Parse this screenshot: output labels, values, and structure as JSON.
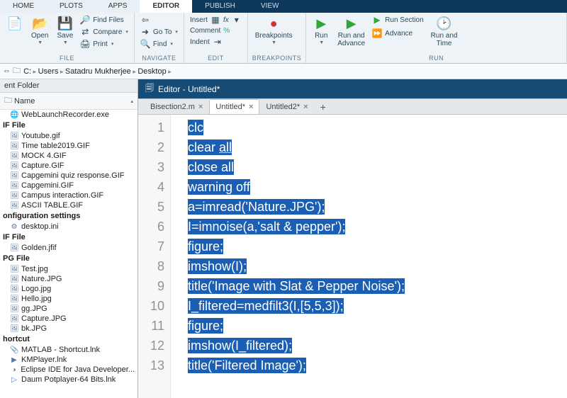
{
  "menutabs": [
    "HOME",
    "PLOTS",
    "APPS",
    "EDITOR",
    "PUBLISH",
    "VIEW"
  ],
  "active_menutab": 3,
  "ribbon": {
    "file": {
      "label": "FILE",
      "open": "Open",
      "save": "Save",
      "find_files": "Find Files",
      "compare": "Compare",
      "print": "Print"
    },
    "navigate": {
      "label": "NAVIGATE",
      "goto": "Go To",
      "find": "Find"
    },
    "edit": {
      "label": "EDIT",
      "insert": "Insert",
      "fx": "fx",
      "comment": "Comment",
      "indent": "Indent"
    },
    "breakpoints": {
      "label": "BREAKPOINTS",
      "breakpoints": "Breakpoints"
    },
    "run": {
      "label": "RUN",
      "run": "Run",
      "advance": "Run and\nAdvance",
      "run_section": "Run Section",
      "adv": "Advance",
      "runtime": "Run and\nTime"
    }
  },
  "breadcrumb": [
    "C:",
    "Users",
    "Satadru Mukherjee",
    "Desktop"
  ],
  "left": {
    "header": "ent Folder",
    "colhead": "Name",
    "groups": [
      {
        "cat": "",
        "items": [
          {
            "icon": "🌐",
            "name": "WebLaunchRecorder.exe"
          }
        ]
      },
      {
        "cat": "IF File",
        "items": [
          {
            "icon": "🖼",
            "name": "Youtube.gif"
          },
          {
            "icon": "🖼",
            "name": "Time table2019.GIF"
          },
          {
            "icon": "🖼",
            "name": "MOCK 4.GIF"
          },
          {
            "icon": "🖼",
            "name": "Capture.GIF"
          },
          {
            "icon": "🖼",
            "name": "Capgemini quiz response.GIF"
          },
          {
            "icon": "🖼",
            "name": "Capgemini.GIF"
          },
          {
            "icon": "🖼",
            "name": "Campus interaction.GIF"
          },
          {
            "icon": "🖼",
            "name": "ASCII TABLE.GIF"
          }
        ]
      },
      {
        "cat": "onfiguration settings",
        "items": [
          {
            "icon": "⚙",
            "name": "desktop.ini"
          }
        ]
      },
      {
        "cat": "IF File",
        "items": [
          {
            "icon": "🖼",
            "name": "Golden.jfif"
          }
        ]
      },
      {
        "cat": "PG File",
        "items": [
          {
            "icon": "🖼",
            "name": "Test.jpg"
          },
          {
            "icon": "🖼",
            "name": "Nature.JPG"
          },
          {
            "icon": "🖼",
            "name": "Logo.jpg"
          },
          {
            "icon": "🖼",
            "name": "Hello.jpg"
          },
          {
            "icon": "🖼",
            "name": "gg.JPG"
          },
          {
            "icon": "🖼",
            "name": "Capture.JPG"
          },
          {
            "icon": "🖼",
            "name": "bk.JPG"
          }
        ]
      },
      {
        "cat": "hortcut",
        "items": [
          {
            "icon": "📎",
            "name": "MATLAB - Shortcut.lnk"
          },
          {
            "icon": "▶",
            "name": "KMPlayer.lnk"
          },
          {
            "icon": "◑",
            "name": "Eclipse IDE for Java Developer..."
          },
          {
            "icon": "▷",
            "name": "Daum Potplayer-64 Bits.lnk"
          }
        ]
      }
    ]
  },
  "editor": {
    "title": "Editor - Untitled*",
    "tabs": [
      {
        "label": "Bisection2.m",
        "active": false
      },
      {
        "label": "Untitled*",
        "active": true
      },
      {
        "label": "Untitled2*",
        "active": false
      }
    ],
    "lines": [
      "clc",
      "clear all",
      "close all",
      "warning off",
      "a=imread('Nature.JPG');",
      "I=imnoise(a,'salt & pepper');",
      "figure;",
      "imshow(I);",
      "title('Image with Slat & Pepper Noise');",
      "I_filtered=medfilt3(I,[5,5,3]);",
      "figure;",
      "imshow(I_filtered);",
      "title('Filtered Image');"
    ]
  }
}
